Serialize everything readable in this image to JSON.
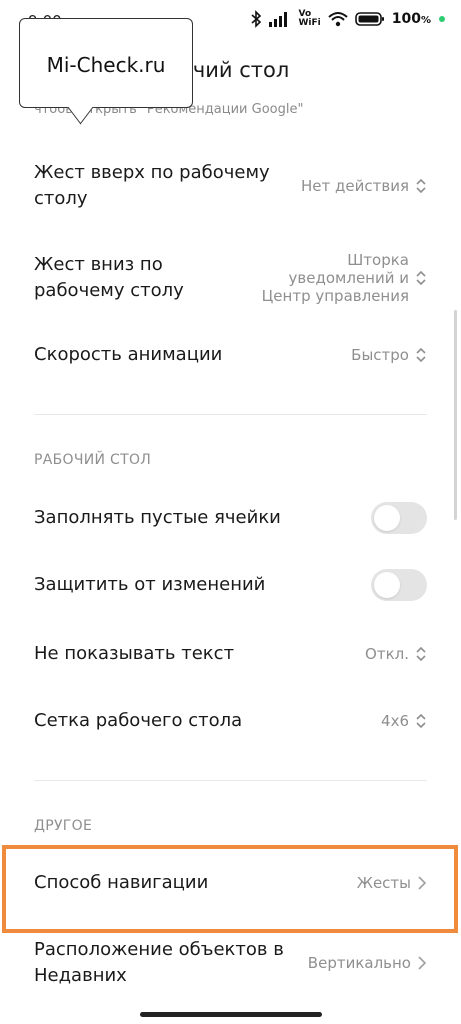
{
  "status_bar": {
    "time": "9:00",
    "network_label_top": "Vo",
    "network_label_bottom": "WiFi",
    "battery": "100",
    "battery_unit": "%"
  },
  "watermark": {
    "text": "Mi-Check.ru"
  },
  "header": {
    "title": "очий стол",
    "subtitle": "чтобы открыть \"Рекомендации Google\""
  },
  "gestures": [
    {
      "label": "Жест вверх по рабочему столу",
      "value": "Нет действия"
    },
    {
      "label": "Жест вниз по рабочему столу",
      "value": "Шторка уведомлений и Центр управления"
    },
    {
      "label": "Скорость анимации",
      "value": "Быстро"
    }
  ],
  "section_desktop": {
    "title": "РАБОЧИЙ СТОЛ",
    "items": [
      {
        "label": "Заполнять пустые ячейки",
        "toggle": false
      },
      {
        "label": "Защитить от изменений",
        "toggle": false
      },
      {
        "label": "Не показывать текст",
        "value": "Откл."
      },
      {
        "label": "Сетка рабочего стола",
        "value": "4x6"
      }
    ]
  },
  "section_other": {
    "title": "ДРУГОЕ",
    "items": [
      {
        "label": "Способ навигации",
        "value": "Жесты"
      },
      {
        "label": "Расположение объектов в Недавних",
        "value": "Вертикально"
      }
    ]
  },
  "colors": {
    "highlight": "#f08a3c",
    "battery_dot": "#2ecc71",
    "secondary_text": "#8f8f8f"
  }
}
